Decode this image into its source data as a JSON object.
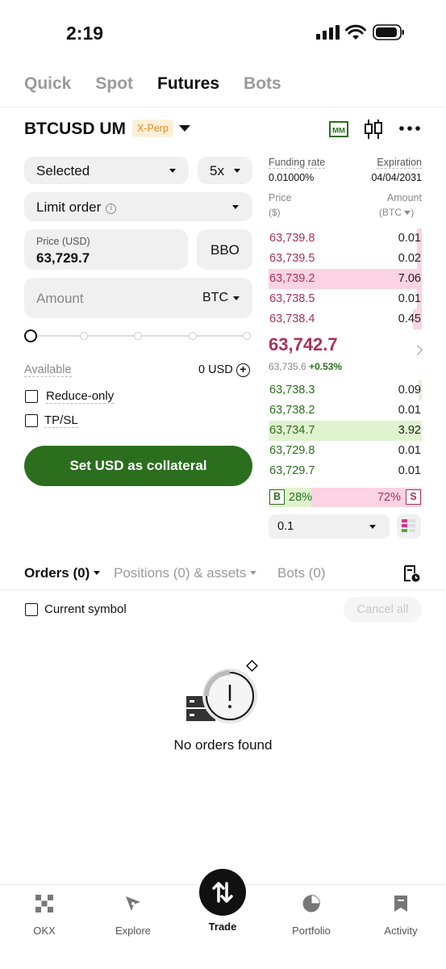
{
  "status_bar": {
    "time": "2:19"
  },
  "top_tabs": [
    {
      "label": "Quick",
      "active": false
    },
    {
      "label": "Spot",
      "active": false
    },
    {
      "label": "Futures",
      "active": true
    },
    {
      "label": "Bots",
      "active": false
    }
  ],
  "header": {
    "symbol": "BTCUSD UM",
    "badge": "X-Perp"
  },
  "form": {
    "margin_mode": "Selected",
    "leverage": "5x",
    "order_type": "Limit order",
    "price_label": "Price (USD)",
    "price_value": "63,729.7",
    "bbo_label": "BBO",
    "amount_placeholder": "Amount",
    "amount_unit": "BTC",
    "slider_level": 0,
    "available_label": "Available",
    "available_value": "0 USD",
    "reduce_only": "Reduce-only",
    "tpsl": "TP/SL",
    "collateral_button": "Set USD as collateral"
  },
  "orderbook": {
    "funding_label": "Funding rate",
    "funding_value": "0.01000%",
    "expiration_label": "Expiration",
    "expiration_value": "04/04/2031",
    "price_col": "Price",
    "price_unit": "($)",
    "amount_col": "Amount",
    "amount_unit": "(BTC",
    "asks": [
      {
        "price": "63,739.8",
        "amount": "0.01",
        "depth": 0.03
      },
      {
        "price": "63,739.5",
        "amount": "0.02",
        "depth": 0.03
      },
      {
        "price": "63,739.2",
        "amount": "7.06",
        "depth": 1.0
      },
      {
        "price": "63,738.5",
        "amount": "0.01",
        "depth": 0.03
      },
      {
        "price": "63,738.4",
        "amount": "0.45",
        "depth": 0.06
      }
    ],
    "mid_price": "63,742.7",
    "mark_price": "63,735.6",
    "change": "+0.53%",
    "bids": [
      {
        "price": "63,738.3",
        "amount": "0.09",
        "depth": 0.02
      },
      {
        "price": "63,738.2",
        "amount": "0.01",
        "depth": 0.0
      },
      {
        "price": "63,734.7",
        "amount": "3.92",
        "depth": 1.0
      },
      {
        "price": "63,729.8",
        "amount": "0.01",
        "depth": 0.0
      },
      {
        "price": "63,729.7",
        "amount": "0.01",
        "depth": 0.0
      }
    ],
    "buy_letter": "B",
    "buy_pct": "28%",
    "sell_letter": "S",
    "sell_pct": "72%",
    "buy_ratio": 0.28,
    "step": "0.1"
  },
  "orders": {
    "tab_orders": "Orders (0)",
    "tab_positions": "Positions (0) & assets",
    "tab_bots": "Bots (0)",
    "current_symbol": "Current symbol",
    "cancel_all": "Cancel all",
    "empty_text": "No orders found"
  },
  "nav": {
    "okx": "OKX",
    "explore": "Explore",
    "trade": "Trade",
    "portfolio": "Portfolio",
    "activity": "Activity"
  },
  "colors": {
    "ask": "#a8325c",
    "bid": "#2b6f1e",
    "primary_button": "#2b6f1e"
  }
}
